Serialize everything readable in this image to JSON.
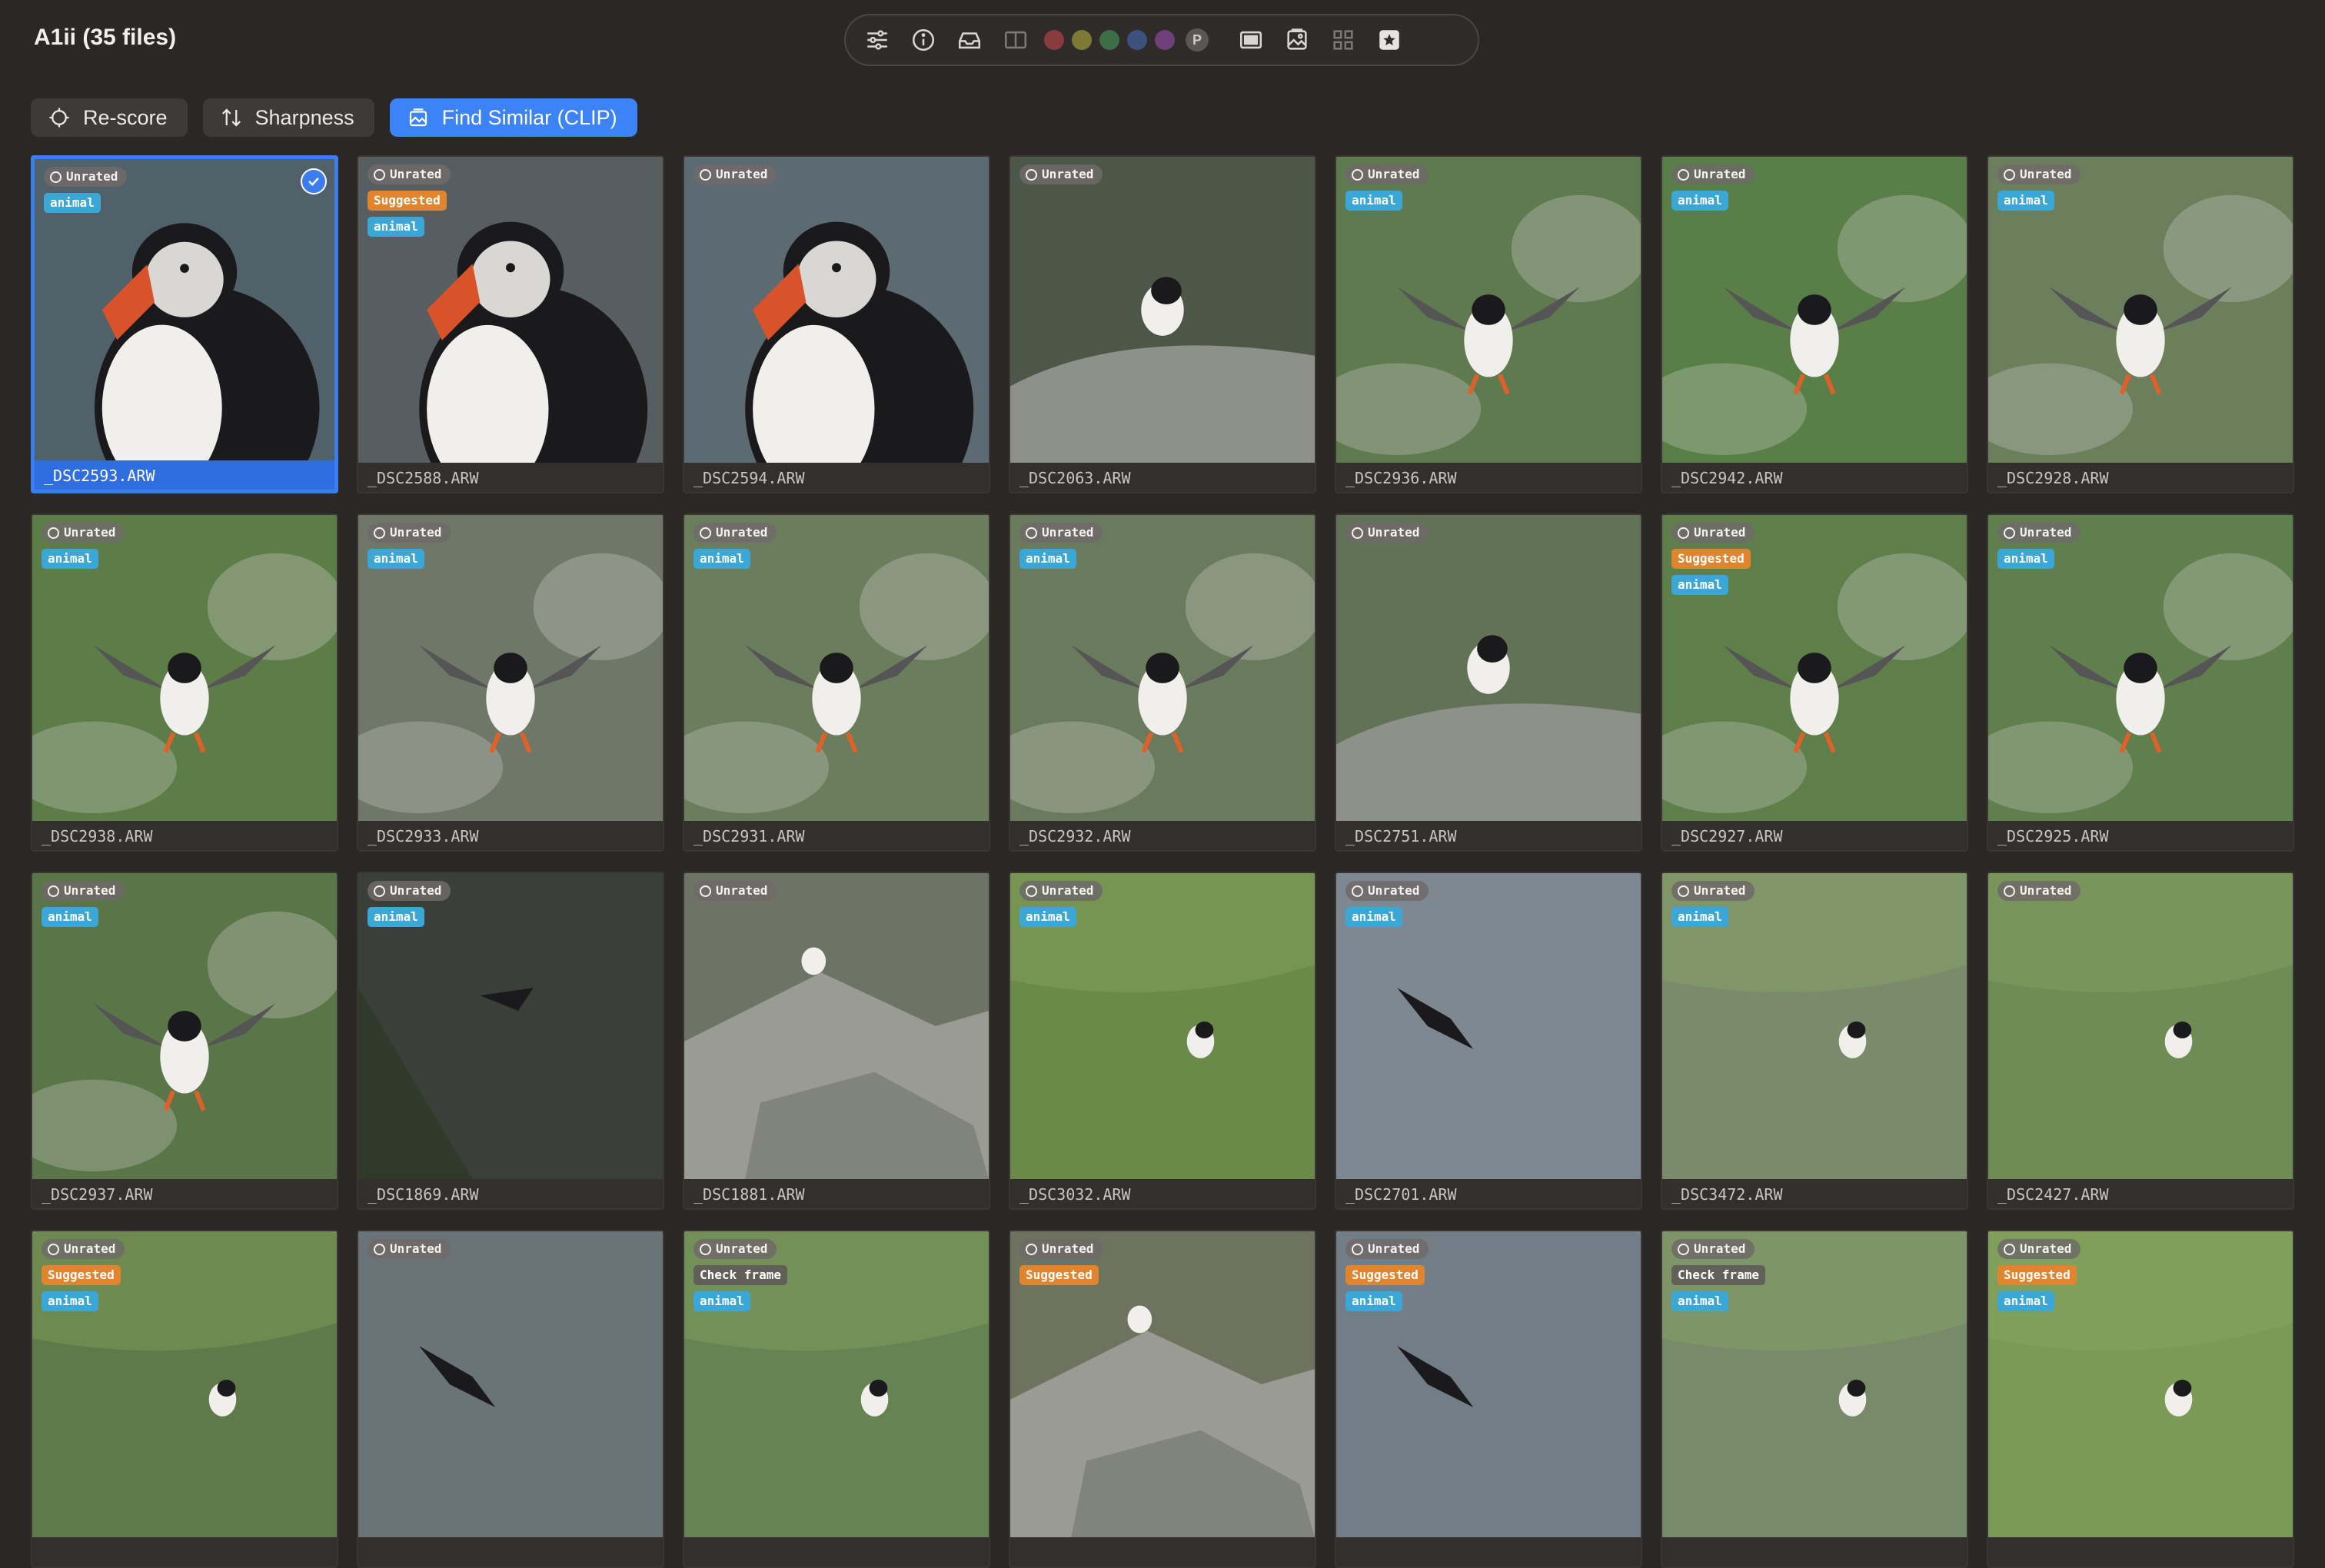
{
  "window": {
    "title": "A1ii (35 files)"
  },
  "toolbar": {
    "icons": [
      "sliders-icon",
      "info-icon",
      "inbox-icon",
      "split-view-icon",
      "color-red",
      "color-olive",
      "color-green",
      "color-blue",
      "color-purple",
      "pick-p",
      "single-view-icon",
      "gallery-icon",
      "grid-icon",
      "star-icon"
    ],
    "color_swatches": [
      "#8a3b3b",
      "#7d7a36",
      "#3d6e45",
      "#3d517f",
      "#6e3f78"
    ],
    "pick_label": "P"
  },
  "actions": {
    "rescore": "Re-score",
    "sharpness": "Sharpness",
    "find_similar": "Find Similar (CLIP)"
  },
  "tiles": [
    {
      "file": "_DSC2593.ARW",
      "badges": [
        "Unrated",
        "animal"
      ],
      "selected": true,
      "scene": "portrait",
      "bg": "#51616a"
    },
    {
      "file": "_DSC2588.ARW",
      "badges": [
        "Unrated",
        "Suggested",
        "animal"
      ],
      "scene": "portrait",
      "bg": "#575e62"
    },
    {
      "file": "_DSC2594.ARW",
      "badges": [
        "Unrated"
      ],
      "scene": "portrait",
      "bg": "#5c6b72"
    },
    {
      "file": "_DSC2063.ARW",
      "badges": [
        "Unrated"
      ],
      "scene": "rock-bird",
      "bg": "#4c5748"
    },
    {
      "file": "_DSC2936.ARW",
      "badges": [
        "Unrated",
        "animal"
      ],
      "scene": "flight",
      "bg": "#5f7a4f"
    },
    {
      "file": "_DSC2942.ARW",
      "badges": [
        "Unrated",
        "animal"
      ],
      "scene": "flight",
      "bg": "#5a7e47"
    },
    {
      "file": "_DSC2928.ARW",
      "badges": [
        "Unrated",
        "animal"
      ],
      "scene": "flight",
      "bg": "#6b7f5c"
    },
    {
      "file": "_DSC2938.ARW",
      "badges": [
        "Unrated",
        "animal"
      ],
      "scene": "flight",
      "bg": "#5d7d48"
    },
    {
      "file": "_DSC2933.ARW",
      "badges": [
        "Unrated",
        "animal"
      ],
      "scene": "flight",
      "bg": "#6f7868"
    },
    {
      "file": "_DSC2931.ARW",
      "badges": [
        "Unrated",
        "animal"
      ],
      "scene": "flight",
      "bg": "#6a7d5c"
    },
    {
      "file": "_DSC2932.ARW",
      "badges": [
        "Unrated",
        "animal"
      ],
      "scene": "flight",
      "bg": "#6a7b5d"
    },
    {
      "file": "_DSC2751.ARW",
      "badges": [
        "Unrated"
      ],
      "scene": "rock-bird",
      "bg": "#627256"
    },
    {
      "file": "_DSC2927.ARW",
      "badges": [
        "Unrated",
        "Suggested",
        "animal"
      ],
      "scene": "flight",
      "bg": "#5e7f4a"
    },
    {
      "file": "_DSC2925.ARW",
      "badges": [
        "Unrated",
        "animal"
      ],
      "scene": "flight",
      "bg": "#5f7f4c"
    },
    {
      "file": "_DSC2937.ARW",
      "badges": [
        "Unrated",
        "animal"
      ],
      "scene": "flight",
      "bg": "#5a7648"
    },
    {
      "file": "_DSC1869.ARW",
      "badges": [
        "Unrated",
        "animal"
      ],
      "scene": "dark",
      "bg": "#3a3f3a"
    },
    {
      "file": "_DSC1881.ARW",
      "badges": [
        "Unrated"
      ],
      "scene": "rocks",
      "bg": "#6d7466"
    },
    {
      "file": "_DSC3032.ARW",
      "badges": [
        "Unrated",
        "animal"
      ],
      "scene": "grass",
      "bg": "#6a8a4a"
    },
    {
      "file": "_DSC2701.ARW",
      "badges": [
        "Unrated",
        "animal"
      ],
      "scene": "sky",
      "bg": "#7d8891"
    },
    {
      "file": "_DSC3472.ARW",
      "badges": [
        "Unrated",
        "animal"
      ],
      "scene": "grass",
      "bg": "#7a8a6b"
    },
    {
      "file": "_DSC2427.ARW",
      "badges": [
        "Unrated"
      ],
      "scene": "grass",
      "bg": "#6f8b56"
    },
    {
      "file": "",
      "badges": [
        "Unrated",
        "Suggested",
        "animal"
      ],
      "scene": "grass",
      "bg": "#5f7a48"
    },
    {
      "file": "",
      "badges": [
        "Unrated"
      ],
      "scene": "sky",
      "bg": "#6a7378"
    },
    {
      "file": "",
      "badges": [
        "Unrated",
        "Check frame",
        "animal"
      ],
      "scene": "grass",
      "bg": "#668353"
    },
    {
      "file": "",
      "badges": [
        "Unrated",
        "Suggested"
      ],
      "scene": "rocks",
      "bg": "#6e735f"
    },
    {
      "file": "",
      "badges": [
        "Unrated",
        "Suggested",
        "animal"
      ],
      "scene": "sky",
      "bg": "#737d86"
    },
    {
      "file": "",
      "badges": [
        "Unrated",
        "Check frame",
        "animal"
      ],
      "scene": "grass",
      "bg": "#778a6a"
    },
    {
      "file": "",
      "badges": [
        "Unrated",
        "Suggested",
        "animal"
      ],
      "scene": "grass",
      "bg": "#7a9a55"
    }
  ]
}
